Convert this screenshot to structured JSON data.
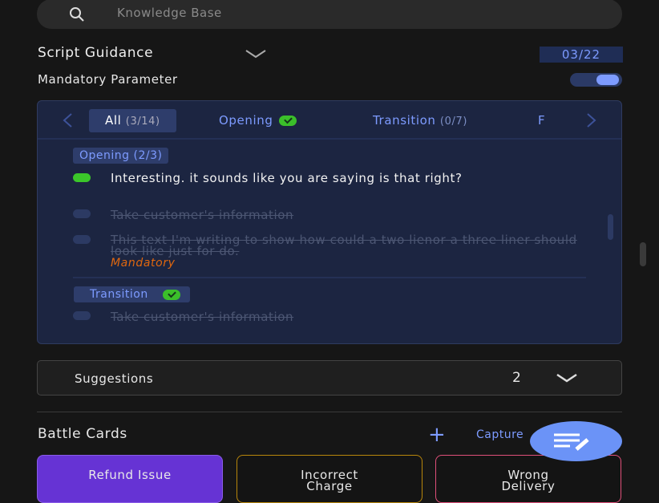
{
  "search": {
    "placeholder": "Knowledge Base",
    "icon": "search-icon"
  },
  "script_guidance": {
    "title": "Script Guidance",
    "counter": "03/22",
    "mandatory_label": "Mandatory Parameter",
    "mandatory_on": true
  },
  "tabs": [
    {
      "label": "All",
      "count": "(3/14)",
      "active": true
    },
    {
      "label": "Opening",
      "count": "",
      "complete": true
    },
    {
      "label": "Transition",
      "count": "(0/7)"
    },
    {
      "label": "F",
      "count": ""
    }
  ],
  "sections": [
    {
      "chip": "Opening (2/3)",
      "items": [
        {
          "text": "Interesting. it sounds like you are saying is that right?",
          "done": false
        },
        {
          "text": "Take customer's information",
          "done": true
        },
        {
          "text": " This text I'm writing to show how could a two lienor a three liner should look like just for do.",
          "done": true,
          "tag": "Mandatory"
        }
      ]
    },
    {
      "chip": "Transition",
      "complete": true,
      "items": [
        {
          "text": "Take customer's information",
          "done": true
        }
      ]
    }
  ],
  "suggestions": {
    "label": "Suggestions",
    "count": "2"
  },
  "battle_cards": {
    "title": "Battle Cards",
    "capture_label": "Capture",
    "cards": [
      {
        "label": "Refund Issue",
        "color": "#6633d4"
      },
      {
        "label": "Incorrect Charge",
        "color": "#b8860b"
      },
      {
        "label": "Wrong Delivery",
        "color": "#e0507a"
      }
    ]
  },
  "colors": {
    "accent": "#7d9bff",
    "success": "#3bc62a",
    "mandatory": "#e0670f"
  }
}
